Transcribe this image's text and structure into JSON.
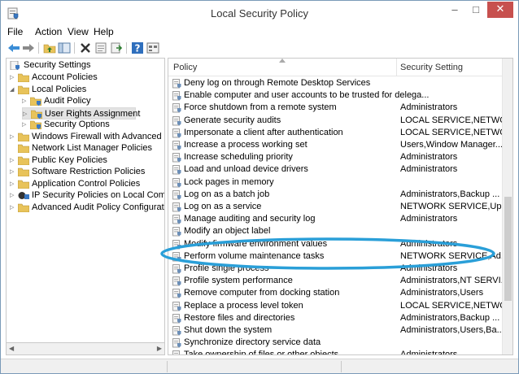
{
  "window": {
    "title": "Local Security Policy",
    "minimize_label": "–",
    "maximize_label": "□",
    "close_label": "✕"
  },
  "menu": [
    "File",
    "Action",
    "View",
    "Help"
  ],
  "toolbar_icons": [
    "back-arrow-icon",
    "forward-arrow-icon",
    "up-folder-icon",
    "show-hide-tree-icon",
    "delete-icon",
    "properties-icon",
    "export-list-icon",
    "help-icon",
    "view-icon"
  ],
  "tree": {
    "root": "Security Settings",
    "items": [
      {
        "label": "Account Policies",
        "level": 1,
        "expand": "▷"
      },
      {
        "label": "Local Policies",
        "level": 1,
        "expand": "◢"
      },
      {
        "label": "Audit Policy",
        "level": 2,
        "expand": "▷"
      },
      {
        "label": "User Rights Assignment",
        "level": 2,
        "expand": "▷",
        "selected": true
      },
      {
        "label": "Security Options",
        "level": 2,
        "expand": "▷"
      },
      {
        "label": "Windows Firewall with Advanced Sec",
        "level": 1,
        "expand": "▷"
      },
      {
        "label": "Network List Manager Policies",
        "level": 1,
        "expand": ""
      },
      {
        "label": "Public Key Policies",
        "level": 1,
        "expand": "▷"
      },
      {
        "label": "Software Restriction Policies",
        "level": 1,
        "expand": "▷"
      },
      {
        "label": "Application Control Policies",
        "level": 1,
        "expand": "▷"
      },
      {
        "label": "IP Security Policies on Local Compute",
        "level": 1,
        "expand": "▷",
        "special": true
      },
      {
        "label": "Advanced Audit Policy Configuration",
        "level": 1,
        "expand": "▷"
      }
    ],
    "scroll_left": "◀",
    "scroll_right": "▶"
  },
  "list": {
    "col_policy": "Policy",
    "col_setting": "Security Setting",
    "rows": [
      {
        "policy": "Deny log on through Remote Desktop Services",
        "setting": ""
      },
      {
        "policy": "Enable computer and user accounts to be trusted for delega...",
        "setting": ""
      },
      {
        "policy": "Force shutdown from a remote system",
        "setting": "Administrators"
      },
      {
        "policy": "Generate security audits",
        "setting": "LOCAL SERVICE,NETWO..."
      },
      {
        "policy": "Impersonate a client after authentication",
        "setting": "LOCAL SERVICE,NETWO..."
      },
      {
        "policy": "Increase a process working set",
        "setting": "Users,Window Manager..."
      },
      {
        "policy": "Increase scheduling priority",
        "setting": "Administrators"
      },
      {
        "policy": "Load and unload device drivers",
        "setting": "Administrators"
      },
      {
        "policy": "Lock pages in memory",
        "setting": ""
      },
      {
        "policy": "Log on as a batch job",
        "setting": "Administrators,Backup ..."
      },
      {
        "policy": "Log on as a service",
        "setting": "NETWORK SERVICE,Upd..."
      },
      {
        "policy": "Manage auditing and security log",
        "setting": "Administrators"
      },
      {
        "policy": "Modify an object label",
        "setting": ""
      },
      {
        "policy": "Modify firmware environment values",
        "setting": "Administrators"
      },
      {
        "policy": "Perform volume maintenance tasks",
        "setting": "NETWORK SERVICE,Ad..."
      },
      {
        "policy": "Profile single process",
        "setting": "Administrators"
      },
      {
        "policy": "Profile system performance",
        "setting": "Administrators,NT SERVI..."
      },
      {
        "policy": "Remove computer from docking station",
        "setting": "Administrators,Users"
      },
      {
        "policy": "Replace a process level token",
        "setting": "LOCAL SERVICE,NETWO..."
      },
      {
        "policy": "Restore files and directories",
        "setting": "Administrators,Backup ..."
      },
      {
        "policy": "Shut down the system",
        "setting": "Administrators,Users,Ba..."
      },
      {
        "policy": "Synchronize directory service data",
        "setting": ""
      },
      {
        "policy": "Take ownership of files or other objects",
        "setting": "Administrators"
      }
    ]
  },
  "colors": {
    "highlight_ellipse": "#2a9fd8",
    "folder": "#e8c35a",
    "close_button": "#c7504e"
  }
}
